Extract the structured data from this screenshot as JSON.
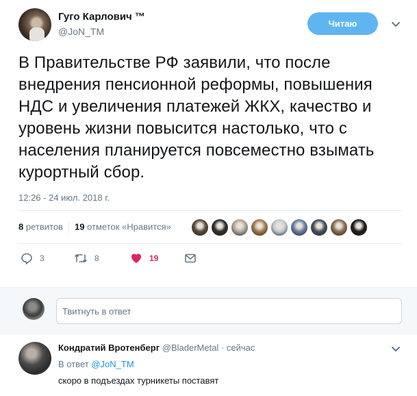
{
  "tweet": {
    "author_name": "Гуго Карлович ™",
    "author_handle": "@JoN_TM",
    "follow_label": "Читаю",
    "text": "В Правительстве РФ заявили, что после внедрения пенсионной реформы, повышения НДС и увеличения платежей ЖКХ, качество и уровень жизни повысится настолько, что с населения планируется повсеместно взымать курортный сбор.",
    "timestamp": "12:26 - 24 июл. 2018 г.",
    "retweets_count": "8",
    "retweets_label": "ретвитов",
    "likes_count": "19",
    "likes_label": "отметок «Нравится»",
    "actions": {
      "reply_count": "3",
      "retweet_count": "8",
      "like_count": "19"
    },
    "likers": [
      "#5a4a3c",
      "#2f2f2f",
      "#b5a99b",
      "#a67c52",
      "#c4ccd4",
      "#6b7fa3",
      "#48525c",
      "#8d6e4f",
      "#1c1c1c"
    ]
  },
  "reply_box": {
    "placeholder": "Твитнуть в ответ"
  },
  "reply": {
    "author_name": "Кондратий Вротенберг",
    "author_handle": "@BladerMetal",
    "time": "· сейчас",
    "reply_to_prefix": "В ответ",
    "reply_to_handle": "@JoN_TM",
    "text": "скоро в подъездах турникеты поставят"
  },
  "colors": {
    "accent": "#1da1f2",
    "follow_button": "#60b5f0",
    "like": "#e0245e",
    "muted": "#657786"
  }
}
